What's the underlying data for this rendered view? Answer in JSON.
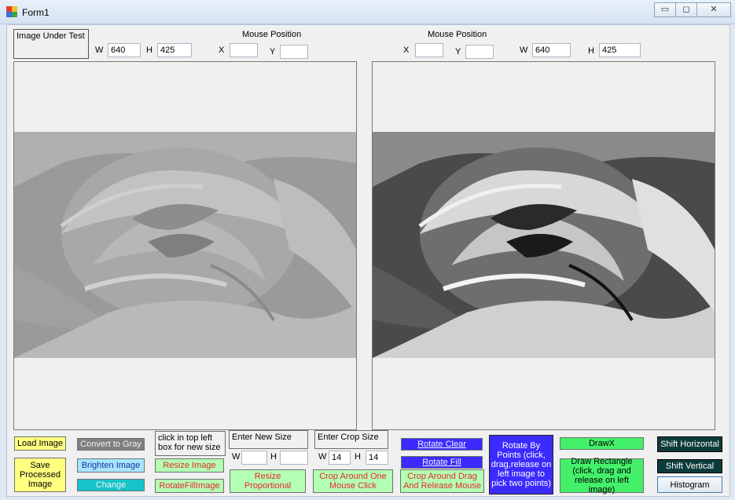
{
  "window": {
    "title": "Form1",
    "controls": {
      "minimize": "▭",
      "maximize": "◻",
      "close": "✕"
    }
  },
  "top": {
    "image_under_test": "Image Under Test",
    "left_w_label": "W",
    "left_w_value": "640",
    "left_h_label": "H",
    "left_h_value": "425",
    "mouse_position_left": "Mouse Position",
    "x_label_left": "X",
    "x_value_left": "",
    "y_label_left": "Y",
    "y_value_left": "",
    "mouse_position_right": "Mouse Position",
    "x_label_right": "X",
    "x_value_right": "",
    "y_label_right": "Y",
    "y_value_right": "",
    "right_w_label": "W",
    "right_w_value": "640",
    "right_h_label": "H",
    "right_h_value": "425"
  },
  "buttons": {
    "load_image": "Load Image",
    "save_processed": "Save Processed Image",
    "convert_gray": "Convert to Gray",
    "brighten": "Brighten Image",
    "change": "Change",
    "resize_hint": "click in top left box for new size",
    "resize_image": "Resize Image",
    "rotate_fill_image": "RotateFillImage",
    "enter_new_size": "Enter New Size",
    "new_w_label": "W",
    "new_w_value": "",
    "new_h_label": "H",
    "new_h_value": "",
    "resize_proportional": "Resize Proportional",
    "enter_crop_size": "Enter Crop Size",
    "crop_w_label": "W",
    "crop_w_value": "14",
    "crop_h_label": "H",
    "crop_h_value": "14",
    "crop_one_click": "Crop Around One Mouse Click",
    "rotate_clear": "Rotate Clear",
    "rotate_fill": "Rotate Fill",
    "crop_drag": "Crop Around Drag And Release Mouse",
    "rotate_by_points": "Rotate By Points (click, drag,release on left image to pick two points)",
    "draw_x": "DrawX",
    "draw_rectangle": "Draw Rectangle (click, drag and release on left image)",
    "shift_horizontal": "Shift Horizontal",
    "shift_vertical": "Shift Vertical",
    "histogram": "Histogram"
  },
  "colors": {
    "yellow": "#ffff80",
    "gray": "#808080",
    "light_blue": "#a6e6ff",
    "cyan": "#16c3c9",
    "light_green": "#b3ffb3",
    "blue": "#3b2bff",
    "green": "#44f06a",
    "dark_teal": "#0d3b3b",
    "red_text": "#e8272a"
  }
}
